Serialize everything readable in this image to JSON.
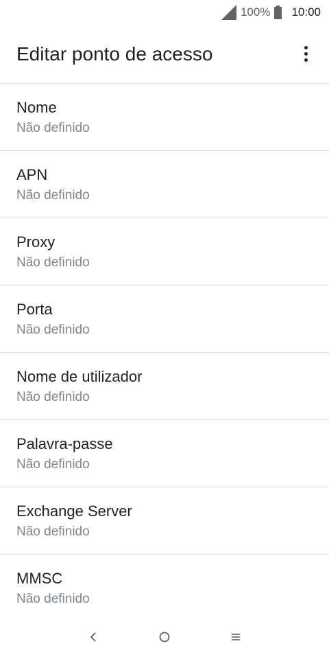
{
  "status_bar": {
    "battery_percent": "100%",
    "time": "10:00"
  },
  "app_bar": {
    "title": "Editar ponto de acesso",
    "more_icon": "more-vert-icon"
  },
  "settings": [
    {
      "title": "Nome",
      "value": "Não definido"
    },
    {
      "title": "APN",
      "value": "Não definido"
    },
    {
      "title": "Proxy",
      "value": "Não definido"
    },
    {
      "title": "Porta",
      "value": "Não definido"
    },
    {
      "title": "Nome de utilizador",
      "value": "Não definido"
    },
    {
      "title": "Palavra-passe",
      "value": "Não definido"
    },
    {
      "title": "Exchange Server",
      "value": "Não definido"
    },
    {
      "title": "MMSC",
      "value": "Não definido"
    }
  ],
  "nav_bar": {
    "back_icon": "back-icon",
    "home_icon": "home-icon",
    "recents_icon": "recents-icon"
  }
}
